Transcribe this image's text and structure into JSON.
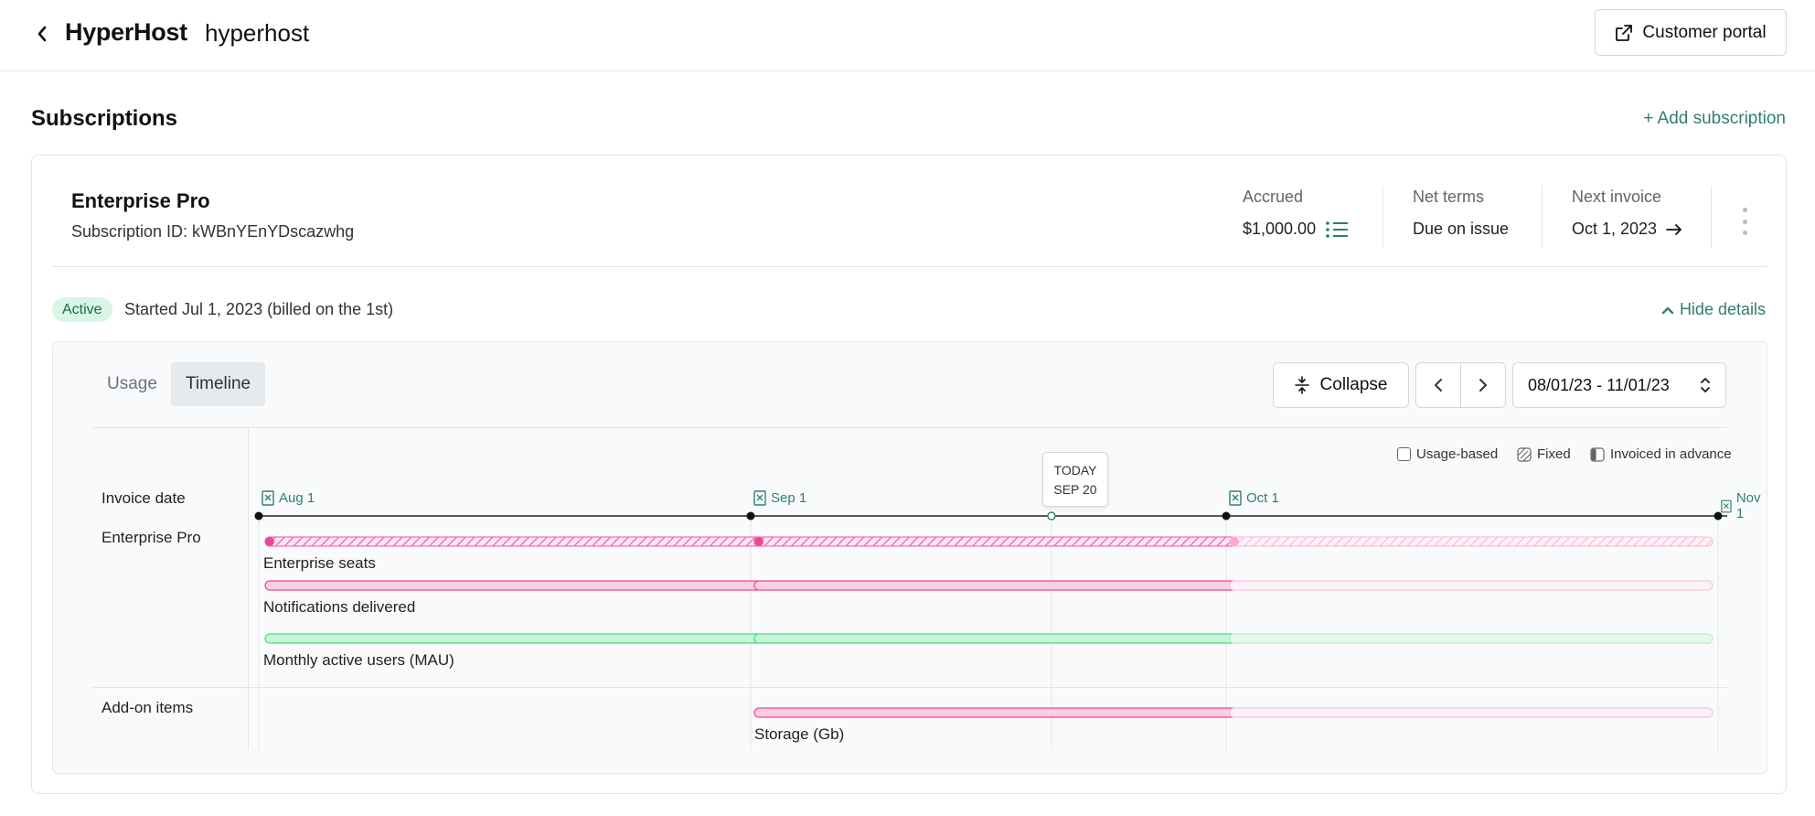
{
  "header": {
    "brand": "HyperHost",
    "slug": "hyperhost",
    "portal_label": "Customer portal"
  },
  "subscriptions": {
    "title": "Subscriptions",
    "add_label": "+ Add subscription"
  },
  "subscription": {
    "plan": "Enterprise Pro",
    "id_text": "Subscription ID: kWBnYEnYDscazwhg",
    "accrued_label": "Accrued",
    "accrued_value": "$1,000.00",
    "net_terms_label": "Net terms",
    "net_terms_value": "Due on issue",
    "next_invoice_label": "Next invoice",
    "next_invoice_value": "Oct 1, 2023",
    "status": "Active",
    "started": "Started Jul 1, 2023 (billed on the 1st)",
    "hide_details": "Hide details"
  },
  "timeline": {
    "tabs": [
      "Usage",
      "Timeline"
    ],
    "active_tab": "Timeline",
    "collapse_label": "Collapse",
    "range_label": "08/01/23 - 11/01/23",
    "legend": [
      "Usage-based",
      "Fixed",
      "Invoiced in advance"
    ],
    "today_top": "TODAY",
    "today_bottom": "SEP 20",
    "row_labels": {
      "invoice_date": "Invoice date",
      "plan": "Enterprise Pro",
      "addons": "Add-on items"
    },
    "dates": [
      "Aug 1",
      "Sep 1",
      "Oct 1",
      "Nov 1"
    ],
    "line_items": [
      {
        "label": "Enterprise seats",
        "type": "fixed"
      },
      {
        "label": "Notifications delivered",
        "type": "usage"
      },
      {
        "label": "Monthly active users (MAU)",
        "type": "usage"
      },
      {
        "label": "Storage (Gb)",
        "type": "usage"
      }
    ]
  },
  "colors": {
    "accent": "#2e7f6f",
    "pink": "#f472b6",
    "pink_fill": "#fbcfe0",
    "green": "#4ade80",
    "green_fill": "#c9f3d9",
    "active_badge": "#d8f5e6"
  }
}
